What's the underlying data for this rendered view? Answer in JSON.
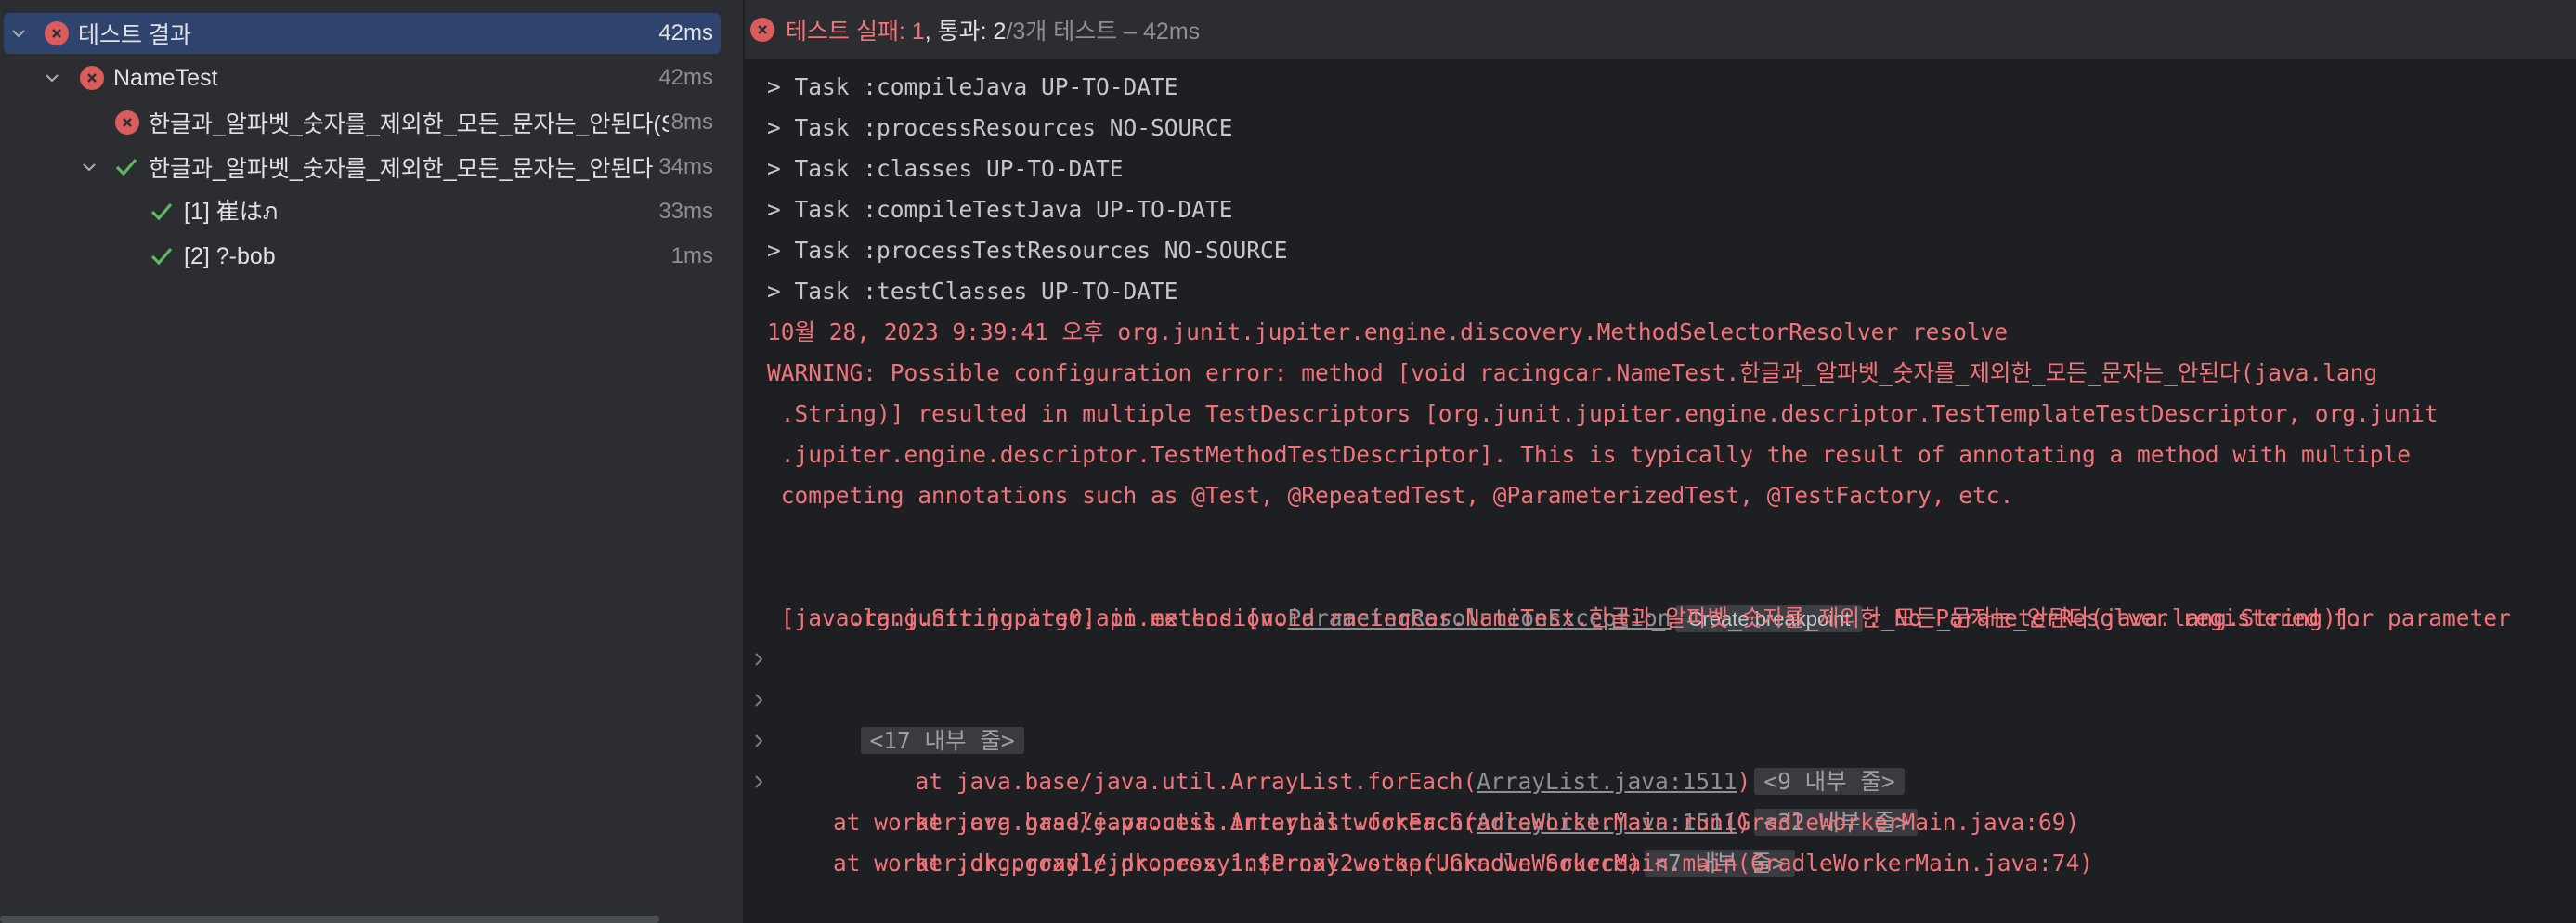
{
  "tree": {
    "root": {
      "label": "테스트 결과",
      "duration": "42ms"
    },
    "class_node": {
      "label": "NameTest",
      "duration": "42ms"
    },
    "children": [
      {
        "label": "한글과_알파벳_숫자를_제외한_모든_문자는_안된다(St",
        "duration": "8ms",
        "status": "failed"
      },
      {
        "label": "한글과_알파벳_숫자를_제외한_모든_문자는_안된다",
        "duration": "34ms",
        "status": "passed"
      }
    ],
    "params": [
      {
        "label": "[1] 崔はภ",
        "duration": "33ms",
        "status": "passed"
      },
      {
        "label": "[2] ?-bob",
        "duration": "1ms",
        "status": "passed"
      }
    ]
  },
  "status_bar": {
    "failed_label": "테스트 실패: 1",
    "passed_label": ", 통과: 2",
    "total_label": " /3개 테스트 – 42ms"
  },
  "console": {
    "tasks": [
      "> Task :compileJava UP-TO-DATE",
      "> Task :processResources NO-SOURCE",
      "> Task :classes UP-TO-DATE",
      "> Task :compileTestJava UP-TO-DATE",
      "> Task :processTestResources NO-SOURCE",
      "> Task :testClasses UP-TO-DATE"
    ],
    "warning_lines": [
      "10월 28, 2023 9:39:41 오후 org.junit.jupiter.engine.discovery.MethodSelectorResolver resolve",
      "WARNING: Possible configuration error: method [void racingcar.NameTest.한글과_알파벳_숫자를_제외한_모든_문자는_안된다(java.lang",
      " .String)] resulted in multiple TestDescriptors [org.junit.jupiter.engine.descriptor.TestTemplateTestDescriptor, org.junit",
      " .jupiter.engine.descriptor.TestMethodTestDescriptor]. This is typically the result of annotating a method with multiple",
      " competing annotations such as @Test, @RepeatedTest, @ParameterizedTest, @TestFactory, etc."
    ],
    "exception_prefix": "org.junit.jupiter.api.extension.",
    "exception_link": "ParameterResolutionException",
    "breakpoint_label": "Create breakpoint",
    "exception_suffix": ": No ParameterResolver registered for parameter",
    "exception_line2": " [java.lang.String arg0] in method [void racingcar.NameTest.한글과_알파벳_숫자를_제외한_모든_문자는_안된다(java.lang.String)].",
    "fold1": "<17 내부 줄>",
    "stack": [
      {
        "prefix": "    at java.base/java.util.ArrayList.forEach(",
        "link": "ArrayList.java:1511",
        "suffix": ")",
        "fold": "<9 내부 줄>"
      },
      {
        "prefix": "    at java.base/java.util.ArrayList.forEach(",
        "link": "ArrayList.java:1511",
        "suffix": ")",
        "fold": "<32 내부 줄>"
      },
      {
        "prefix": "    at jdk.proxy1/jdk.proxy1.$Proxy2.stop(Unknown Source)",
        "link": "",
        "suffix": "",
        "fold": "<7 내부 줄>"
      }
    ],
    "tail": [
      "    at worker.org.gradle.process.internal.worker.GradleWorkerMain.run(GradleWorkerMain.java:69)",
      "    at worker.org.gradle.process.internal.worker.GradleWorkerMain.main(GradleWorkerMain.java:74)"
    ]
  },
  "colors": {
    "fail": "#db5c5c",
    "pass": "#5fb865",
    "error_text": "#f0747a",
    "selection": "#2e436e"
  }
}
